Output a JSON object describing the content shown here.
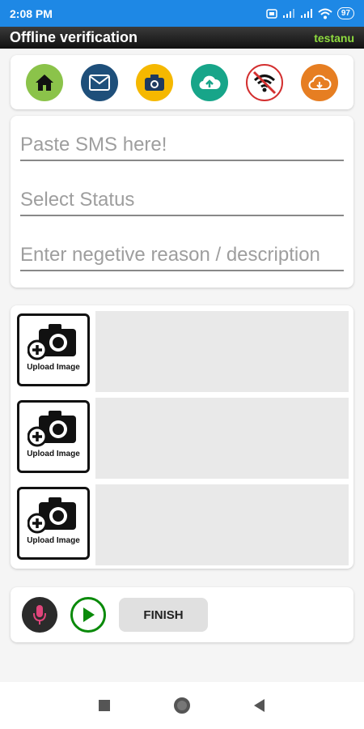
{
  "status_bar": {
    "time": "2:08 PM",
    "battery": "97"
  },
  "app_bar": {
    "title": "Offline verification",
    "user": "testanu"
  },
  "toolbar": {
    "icons": [
      {
        "name": "home-icon",
        "color": "#8bc34a"
      },
      {
        "name": "mail-icon",
        "color": "#1e4f7a"
      },
      {
        "name": "camera-icon",
        "color": "#f5b800"
      },
      {
        "name": "cloud-upload-icon",
        "color": "#17a589"
      },
      {
        "name": "no-wifi-icon",
        "color": "#d32f2f"
      },
      {
        "name": "cloud-download-icon",
        "color": "#e67e22"
      }
    ]
  },
  "form": {
    "sms_placeholder": "Paste SMS here!",
    "status_placeholder": "Select Status",
    "reason_placeholder": "Enter negetive reason / description"
  },
  "images": {
    "upload_label": "Upload Image",
    "slots": [
      {
        "label": "Upload Image"
      },
      {
        "label": "Upload Image"
      },
      {
        "label": "Upload Image"
      }
    ]
  },
  "actions": {
    "finish_label": "FINISH"
  },
  "colors": {
    "status_bar": "#1e88e5",
    "app_user": "#8fdc3f",
    "play_green": "#0a8a0a",
    "mic_pink": "#e0457b"
  }
}
